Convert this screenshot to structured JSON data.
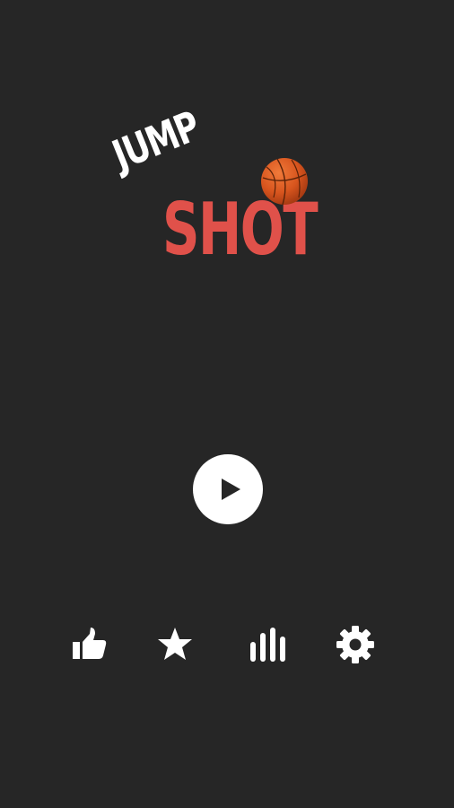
{
  "logo": {
    "line1": "JUMP",
    "line2": "SHOT",
    "colors": {
      "line1": "#ffffff",
      "line2": "#e0514a",
      "ball": "#d8551e"
    }
  },
  "buttons": {
    "play": {
      "icon": "play-icon"
    },
    "like": {
      "icon": "thumbs-up-icon"
    },
    "rate": {
      "icon": "star-icon"
    },
    "leaderboard": {
      "icon": "bar-chart-icon"
    },
    "settings": {
      "icon": "gear-icon"
    }
  },
  "colors": {
    "background": "#262626",
    "icon": "#ffffff",
    "play_triangle": "#262626"
  }
}
